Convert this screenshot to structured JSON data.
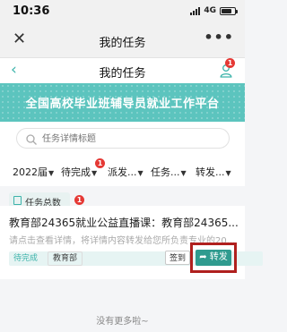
{
  "status_bar": {
    "time": "10:36",
    "network": "4G",
    "battery_level": 0.8
  },
  "navbar": {
    "close": "✕",
    "title": "我的任务",
    "more": "•••"
  },
  "page_header": {
    "back": "‹",
    "title": "我的任务",
    "badge": "1"
  },
  "banner": {
    "title": "全国高校毕业班辅导员就业工作平台"
  },
  "search": {
    "placeholder": "任务详情标题"
  },
  "filters": [
    {
      "label": "2022届"
    },
    {
      "label": "待完成",
      "badge": "1"
    },
    {
      "label": "派发..."
    },
    {
      "label": "任务..."
    },
    {
      "label": "转发..."
    }
  ],
  "summary": {
    "label": "任务总数",
    "count": "1"
  },
  "task": {
    "title": "教育部24365就业公益直播课：教育部24365...",
    "description": "请点击查看详情，将详情内容转发给您所负责专业的20...",
    "status_tag": "待完成",
    "org_tag": "教育部",
    "sign_label": "签到",
    "forward_label": "转发"
  },
  "footer": {
    "text": "没有更多啦~"
  },
  "colors": {
    "accent": "#3bb3aa",
    "banner": "#5cc4be",
    "forward": "#2f9b8f",
    "highlight": "#b0201e",
    "badge": "#e53935"
  }
}
